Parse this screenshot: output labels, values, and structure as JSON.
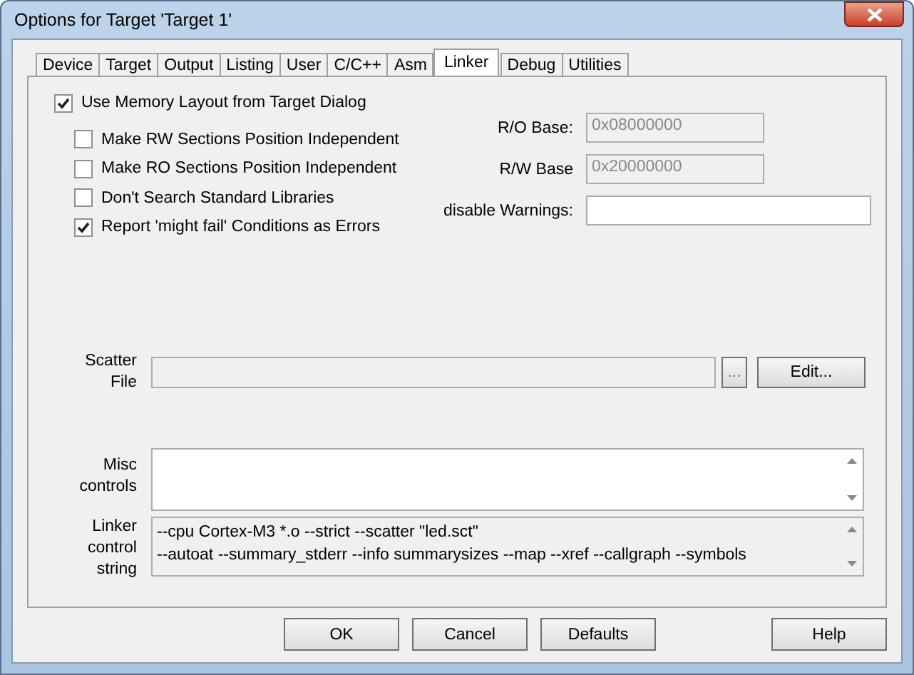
{
  "window": {
    "title": "Options for Target 'Target 1'"
  },
  "tabs": [
    {
      "label": "Device",
      "selected": false
    },
    {
      "label": "Target",
      "selected": false
    },
    {
      "label": "Output",
      "selected": false
    },
    {
      "label": "Listing",
      "selected": false
    },
    {
      "label": "User",
      "selected": false
    },
    {
      "label": "C/C++",
      "selected": false
    },
    {
      "label": "Asm",
      "selected": false
    },
    {
      "label": "Linker",
      "selected": true
    },
    {
      "label": "Debug",
      "selected": false
    },
    {
      "label": "Utilities",
      "selected": false
    }
  ],
  "main_option": {
    "label": "Use Memory Layout from Target Dialog",
    "checked": true
  },
  "options": [
    {
      "label": "Make RW Sections Position Independent",
      "checked": false
    },
    {
      "label": "Make RO Sections Position Independent",
      "checked": false
    },
    {
      "label": "Don't Search Standard Libraries",
      "checked": false
    },
    {
      "label": "Report 'might fail' Conditions as Errors",
      "checked": true
    }
  ],
  "fields": [
    {
      "label": "R/O Base:",
      "value": "0x08000000",
      "disabled": true
    },
    {
      "label": "R/W Base",
      "value": "0x20000000",
      "disabled": true
    },
    {
      "label": "disable Warnings:",
      "disabled": false
    }
  ],
  "scatter_file": {
    "label_lines": [
      "Scatter",
      "File"
    ],
    "disabled": true,
    "browse_button": "...",
    "edit_button": "Edit..."
  },
  "misc_controls": {
    "label_lines": [
      "Misc",
      "controls"
    ]
  },
  "linker_control_string": {
    "label_lines": [
      "Linker",
      "control",
      "string"
    ],
    "lines": [
      "--cpu Cortex-M3 *.o --strict --scatter \"led.sct\"",
      "--autoat --summary_stderr --info summarysizes --map --xref --callgraph --symbols"
    ]
  },
  "buttons": [
    "OK",
    "Cancel",
    "Defaults"
  ],
  "help_button": "Help"
}
